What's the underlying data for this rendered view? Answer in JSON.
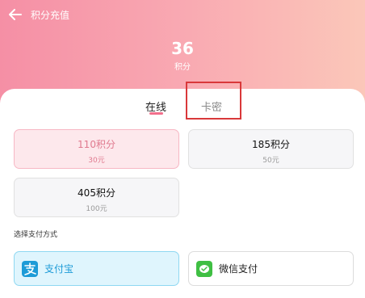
{
  "header": {
    "title": "积分充值",
    "points_value": "36",
    "points_label": "积分"
  },
  "tabs": {
    "online": "在线",
    "card_code": "卡密"
  },
  "packages": [
    {
      "name": "110积分",
      "price": "30元",
      "selected": true
    },
    {
      "name": "185积分",
      "price": "50元",
      "selected": false
    },
    {
      "name": "405积分",
      "price": "100元",
      "selected": false
    }
  ],
  "payment": {
    "label": "选择支付方式",
    "alipay": "支付宝",
    "wechat": "微信支付"
  },
  "colors": {
    "accent_pink": "#f26f8c",
    "selected_bg": "#fde8ec",
    "alipay_blue": "#1d9bd7",
    "wechat_green": "#3fbf43",
    "highlight_red": "#d9383a"
  },
  "icons": [
    "back-arrow-icon",
    "alipay-icon",
    "wechat-pay-icon"
  ]
}
